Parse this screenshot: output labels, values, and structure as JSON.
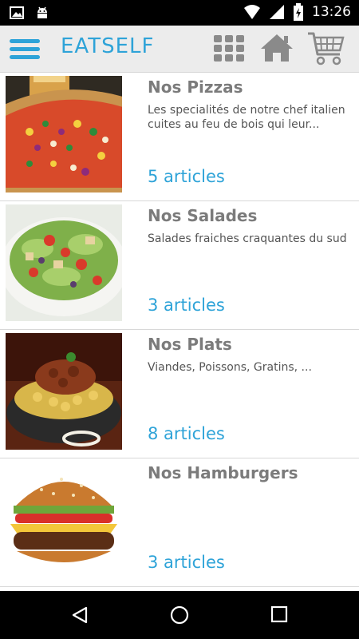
{
  "status_bar": {
    "time": "13:26",
    "icons": [
      "image-icon",
      "android-icon",
      "wifi-icon",
      "signal-icon",
      "battery-charging-icon"
    ]
  },
  "app_bar": {
    "title": "EATSELF",
    "icons": [
      "menu-icon",
      "grid-icon",
      "home-icon",
      "cart-icon"
    ],
    "accent_color": "#2ea3d8"
  },
  "categories": [
    {
      "title": "Nos Pizzas",
      "description": "Les specialités de notre chef italien cuites au feu de bois qui leur...",
      "count": "5 articles",
      "image": "pizza"
    },
    {
      "title": "Nos Salades",
      "description": "Salades fraiches craquantes du sud",
      "count": "3 articles",
      "image": "salad"
    },
    {
      "title": "Nos Plats",
      "description": "Viandes, Poissons, Gratins, ...",
      "count": "8 articles",
      "image": "pasta"
    },
    {
      "title": "Nos Hamburgers",
      "description": "",
      "count": "3 articles",
      "image": "hamburger"
    }
  ],
  "nav_bar": {
    "icons": [
      "back-icon",
      "home-circle-icon",
      "recents-icon"
    ]
  }
}
